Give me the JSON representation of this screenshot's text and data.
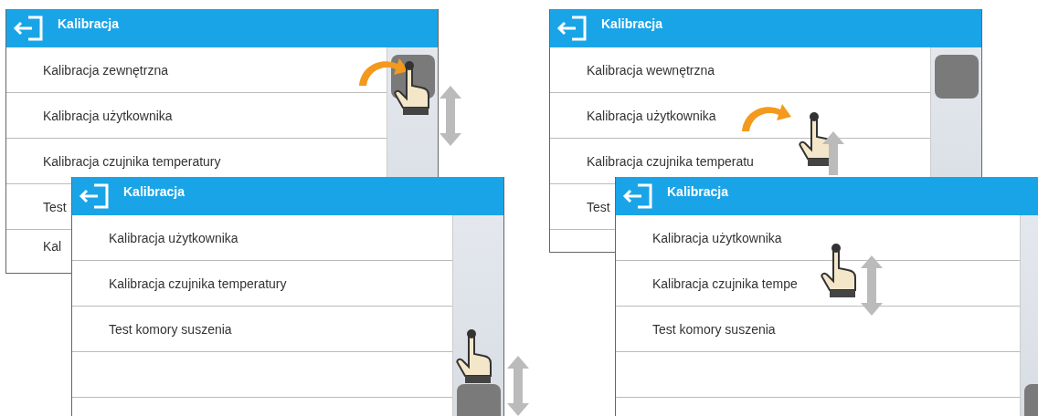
{
  "screens": [
    {
      "title": "Kalibracja",
      "rows": [
        "Kalibracja zewnętrzna",
        "Kalibracja użytkownika",
        "Kalibracja czujnika temperatury",
        "Test",
        "Kal"
      ]
    },
    {
      "title": "Kalibracja",
      "rows": [
        "Kalibracja użytkownika",
        "Kalibracja czujnika temperatury",
        "Test komory suszenia"
      ]
    },
    {
      "title": "Kalibracja",
      "rows": [
        "Kalibracja wewnętrzna",
        "Kalibracja użytkownika",
        "Kalibracja czujnika temperatu",
        "Test"
      ]
    },
    {
      "title": "Kalibracja",
      "rows": [
        "Kalibracja użytkownika",
        "Kalibracja czujnika tempe",
        "Test komory suszenia"
      ]
    }
  ]
}
